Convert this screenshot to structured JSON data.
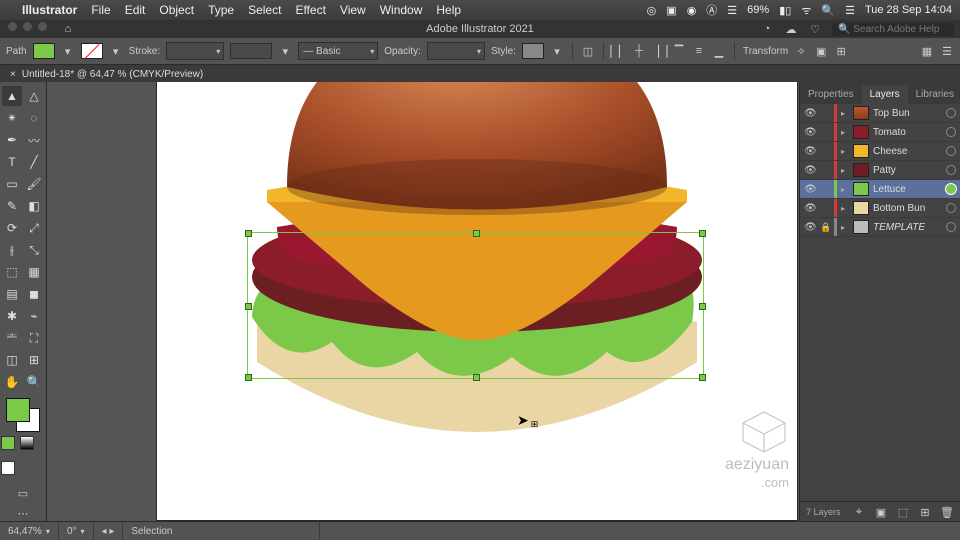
{
  "mac_menu": {
    "app": "Illustrator",
    "items": [
      "File",
      "Edit",
      "Object",
      "Type",
      "Select",
      "Effect",
      "View",
      "Window",
      "Help"
    ]
  },
  "mac_right": {
    "battery": "69%",
    "wifi": "◦",
    "clock": "Tue 28 Sep  14:04"
  },
  "window_title": "Adobe Illustrator 2021",
  "search_placeholder": "Search Adobe Help",
  "control_bar": {
    "path_label": "Path",
    "stroke_label": "Stroke:",
    "stroke_width": "",
    "profile": "Basic",
    "opacity_label": "Opacity:",
    "opacity": "",
    "style_label": "Style:",
    "transform": "Transform"
  },
  "doc_tab": "Untitled-18* @ 64,47 % (CMYK/Preview)",
  "panel": {
    "tabs": [
      "Properties",
      "Layers",
      "Libraries"
    ],
    "active": "Layers",
    "layers": [
      {
        "name": "Top Bun",
        "color": "#d63b3b",
        "thumb": "linear-gradient(#b85a2e,#8d3a1d)",
        "locked": false,
        "visible": true,
        "selected": false,
        "target": false
      },
      {
        "name": "Tomato",
        "color": "#d63b3b",
        "thumb": "#8b1d2b",
        "locked": false,
        "visible": true,
        "selected": false,
        "target": false
      },
      {
        "name": "Cheese",
        "color": "#d63b3b",
        "thumb": "#f3b62a",
        "locked": false,
        "visible": true,
        "selected": false,
        "target": false
      },
      {
        "name": "Patty",
        "color": "#d63b3b",
        "thumb": "#6b1f22",
        "locked": false,
        "visible": true,
        "selected": false,
        "target": false
      },
      {
        "name": "Lettuce",
        "color": "#7cc94a",
        "thumb": "#7cc94a",
        "locked": false,
        "visible": true,
        "selected": true,
        "target": true
      },
      {
        "name": "Bottom Bun",
        "color": "#d63b3b",
        "thumb": "#ead6a5",
        "locked": false,
        "visible": true,
        "selected": false,
        "target": false
      },
      {
        "name": "TEMPLATE",
        "color": "#888",
        "thumb": "#bbb",
        "locked": true,
        "visible": true,
        "italic": true,
        "selected": false,
        "target": false
      }
    ],
    "footer": "7 Layers"
  },
  "status": {
    "zoom": "64,47%",
    "rotate": "0°",
    "tool": "Selection"
  },
  "watermark": {
    "line1": "aeziyuan",
    "line2": ".com"
  },
  "tool_names": [
    "selection",
    "direct-selection",
    "magic-wand",
    "lasso",
    "pen",
    "curvature",
    "type",
    "line",
    "rectangle",
    "paintbrush",
    "shaper",
    "eraser",
    "rotate",
    "scale",
    "width",
    "free-transform",
    "shape-builder",
    "perspective",
    "mesh",
    "gradient",
    "eyedropper",
    "blend",
    "symbol-sprayer",
    "column-graph",
    "artboard",
    "slice",
    "hand",
    "zoom"
  ],
  "tool_glyphs": [
    "▲",
    "△",
    "✴",
    "◌",
    "✒",
    "〰",
    "T",
    "╱",
    "▭",
    "🖌",
    "✎",
    "◧",
    "⟳",
    "⤢",
    "⫲",
    "⤡",
    "⬚",
    "▦",
    "▤",
    "◼",
    "✱",
    "⌁",
    "⎃",
    "⛶",
    "◫",
    "⊞",
    "✋",
    "🔍"
  ]
}
